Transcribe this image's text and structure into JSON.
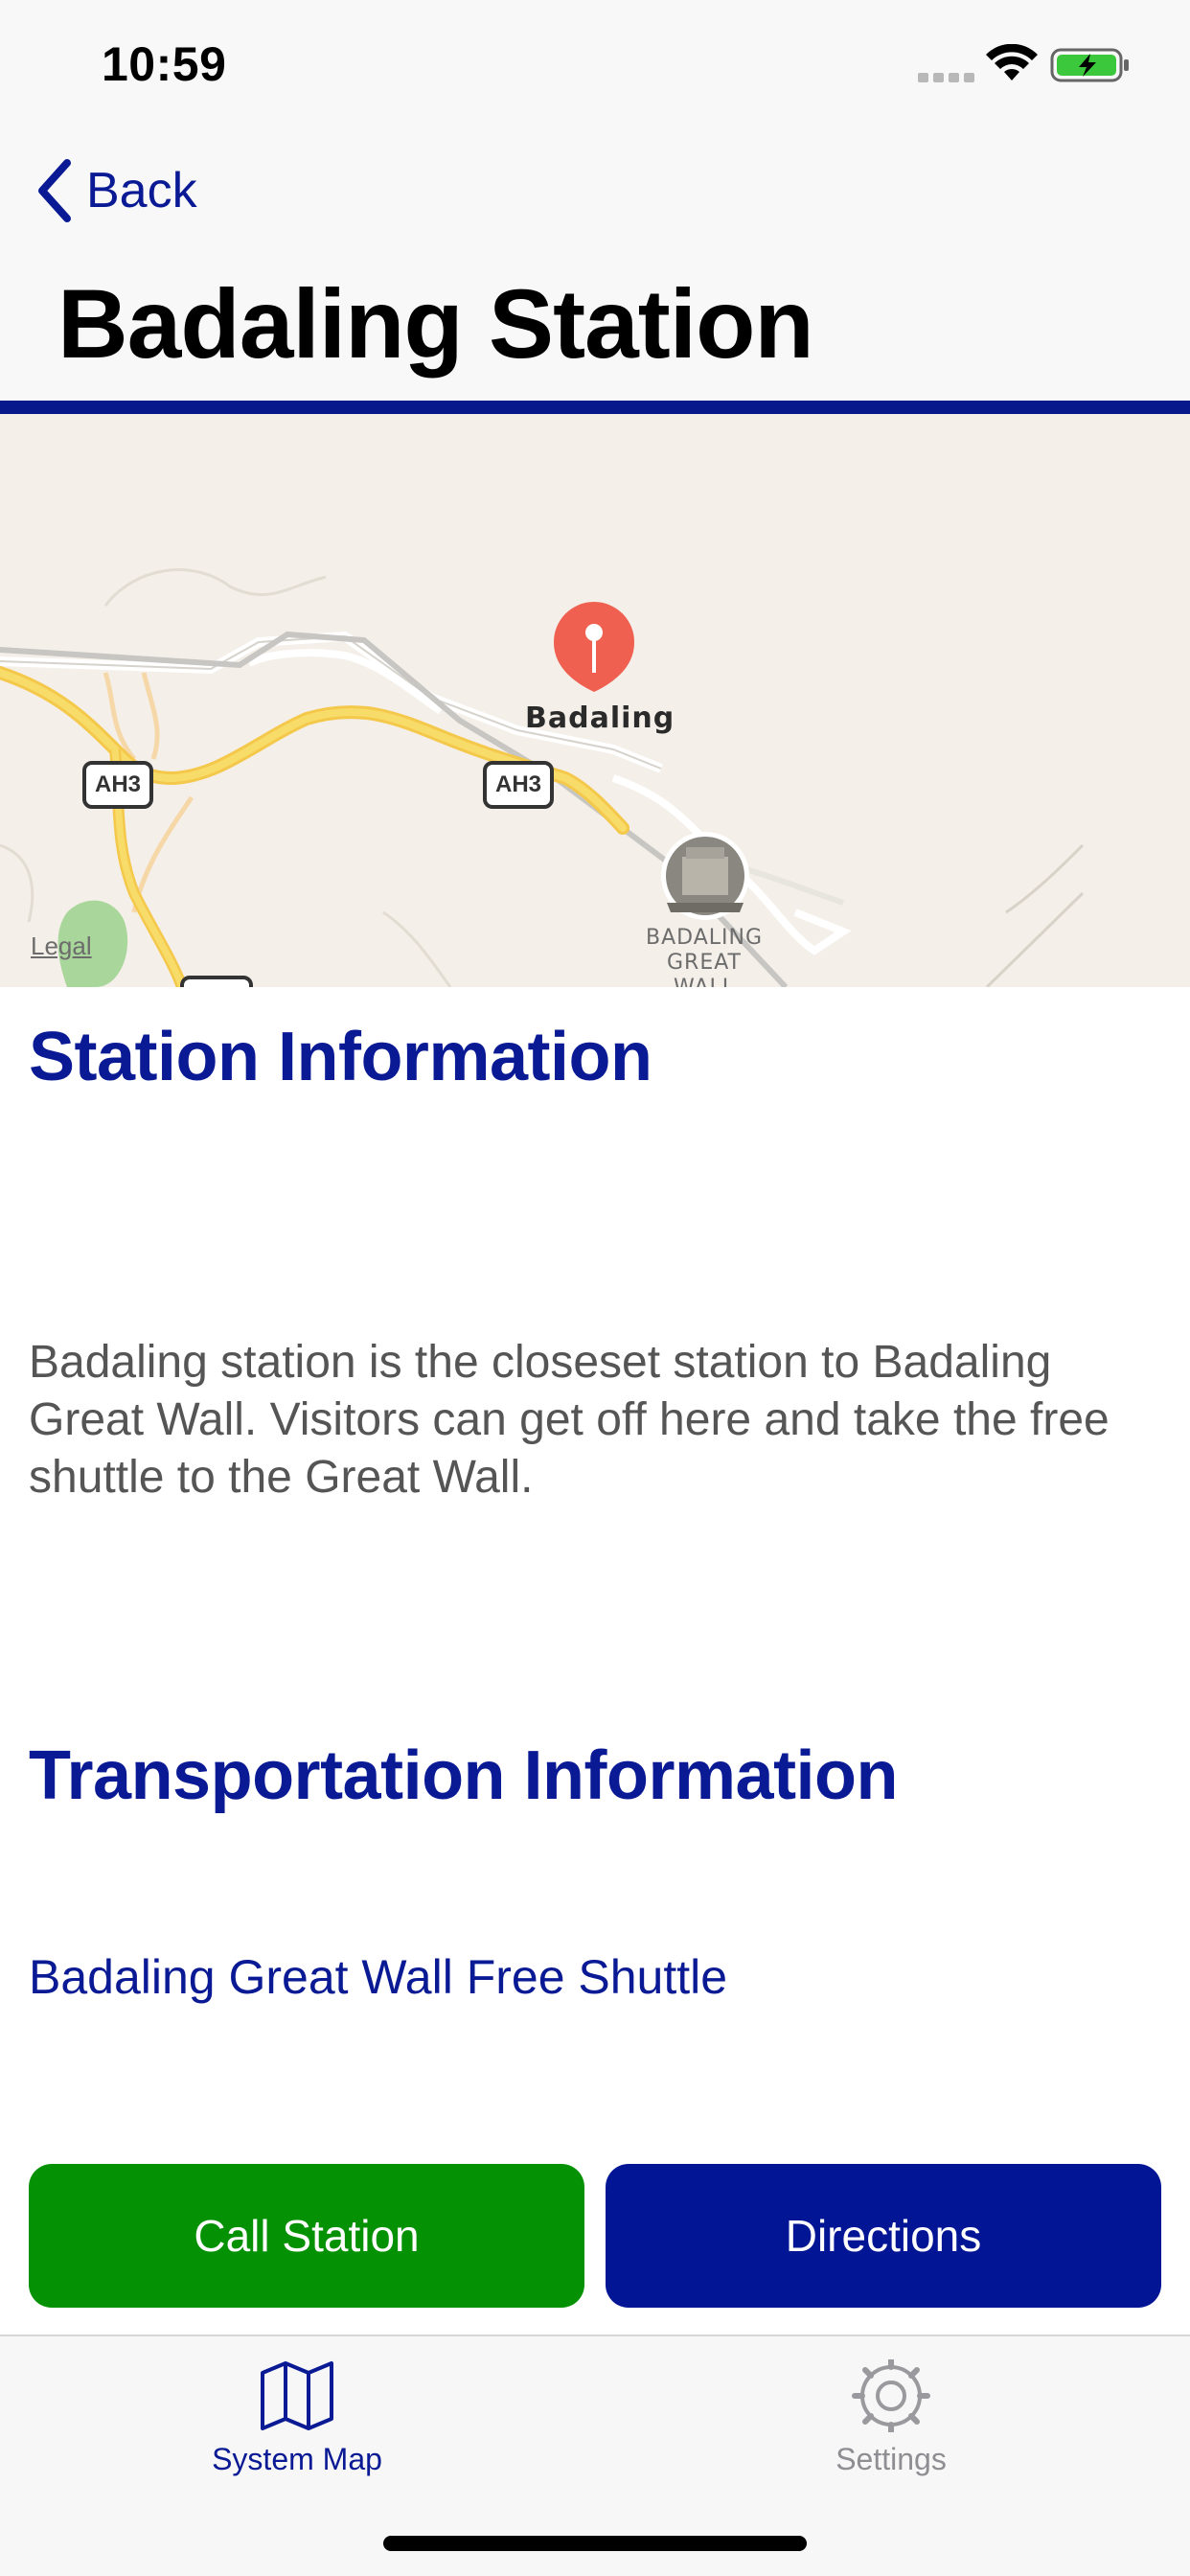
{
  "status_bar": {
    "time": "10:59",
    "signal_icon": "cellular-signal-icon",
    "wifi_icon": "wifi-icon",
    "battery_icon": "battery-charging-icon",
    "battery_color": "#3cc83c"
  },
  "nav": {
    "back_label": "Back",
    "back_icon": "chevron-left-icon",
    "title": "Badaling Station",
    "accent_color": "#08198c"
  },
  "map": {
    "pin_label": "Badaling",
    "poi_label_line1": "BADALING",
    "poi_label_line2": "GREAT WALL",
    "road_shield_1": "AH3",
    "road_shield_2": "AH3",
    "legal": "Legal",
    "pin_icon": "map-pin-icon",
    "poi_icon": "great-wall-poi-icon"
  },
  "station_info": {
    "heading": "Station Information",
    "description": "Badaling station is the closeset station to Badaling Great Wall. Visitors can get off here and take the free shuttle to the Great Wall."
  },
  "transportation": {
    "heading": "Transportation Information",
    "link": "Badaling Great Wall Free Shuttle"
  },
  "actions": {
    "call_label": "Call Station",
    "call_color": "#049204",
    "directions_label": "Directions",
    "directions_color": "#021595"
  },
  "tabbar": {
    "tabs": [
      {
        "label": "System Map",
        "icon": "map-icon",
        "selected": true
      },
      {
        "label": "Settings",
        "icon": "gear-icon",
        "selected": false
      }
    ]
  }
}
